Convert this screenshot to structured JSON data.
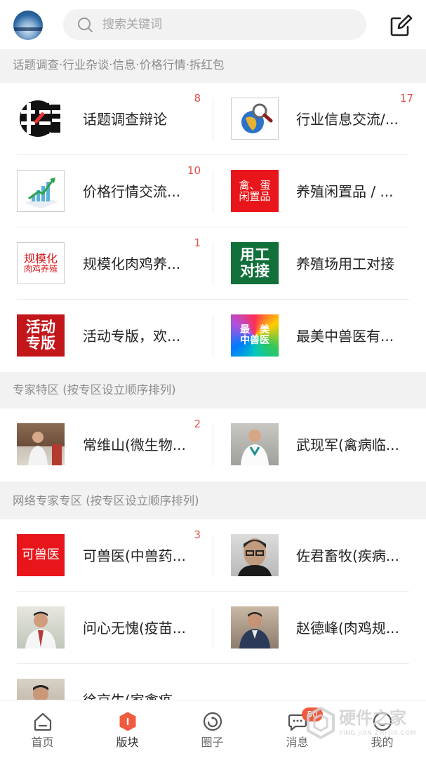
{
  "header": {
    "search_placeholder": "搜索关键词"
  },
  "sections": [
    {
      "title": "话题调查·行业杂谈·信息·价格行情·拆红包"
    },
    {
      "title": "专家特区 (按专区设立顺序排列)"
    },
    {
      "title": "网络专家专区 (按专区设立顺序排列)"
    }
  ],
  "forums": [
    {
      "name": "话题调查辩论",
      "count": "8"
    },
    {
      "name": "行业信息交流/...",
      "count": "17"
    },
    {
      "name": "价格行情交流...",
      "count": "10"
    },
    {
      "name": "养殖闲置品 / ...",
      "count": ""
    },
    {
      "name": "规模化肉鸡养...",
      "count": "1"
    },
    {
      "name": "养殖场用工对接",
      "count": ""
    },
    {
      "name": "活动专版，欢...",
      "count": ""
    },
    {
      "name": "最美中兽医有...",
      "count": ""
    },
    {
      "name": "常维山(微生物...",
      "count": "2"
    },
    {
      "name": "武现军(禽病临...",
      "count": ""
    },
    {
      "name": "可兽医(中兽药...",
      "count": "3"
    },
    {
      "name": "佐君畜牧(疾病...",
      "count": ""
    },
    {
      "name": "问心无愧(疫苗...",
      "count": ""
    },
    {
      "name": "赵德峰(肉鸡规...",
      "count": ""
    },
    {
      "name": "徐京生(家禽疫",
      "count": ""
    }
  ],
  "thumb_text": {
    "price": "",
    "idle_line1": "禽、蛋",
    "idle_line2": "闲置品",
    "scale_line1": "规模化",
    "scale_line2": "肉鸡养殖",
    "work_line1": "用工",
    "work_line2": "对接",
    "activity_line1": "活动",
    "activity_line2": "专版",
    "beauty_line1": "最　美",
    "beauty_line2": "中兽医",
    "kevet": "可兽医"
  },
  "nav": {
    "items": [
      {
        "label": "首页"
      },
      {
        "label": "版块"
      },
      {
        "label": "圈子"
      },
      {
        "label": "消息"
      },
      {
        "label": "我的"
      }
    ],
    "message_badge": "50"
  },
  "watermark": {
    "text": "硬件之家",
    "sub": "YING JIAN ZHI JIA.COM"
  },
  "colors": {
    "accent": "#f05b3f",
    "count_red": "#e0504d",
    "section_bg": "#f2f2f2"
  }
}
